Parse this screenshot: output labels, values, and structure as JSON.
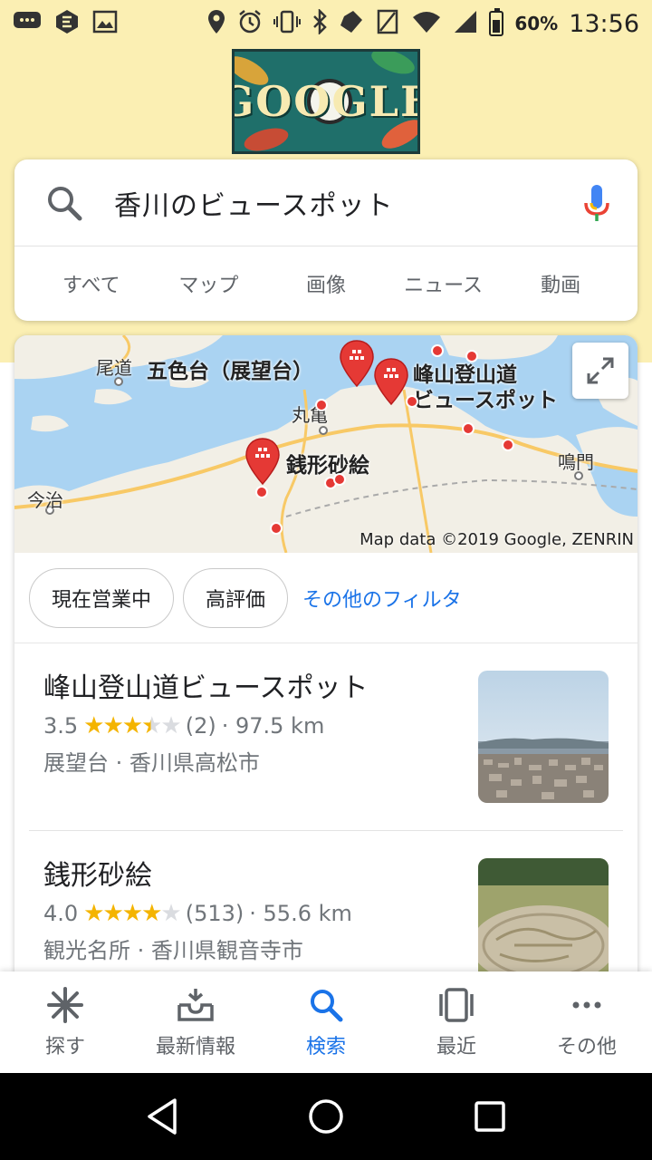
{
  "status_bar": {
    "left_icons": [
      "message-icon",
      "e-app-icon",
      "image-icon"
    ],
    "right_icons": [
      "location-icon",
      "alarm-icon",
      "vibrate-icon",
      "bluetooth-icon",
      "nfc-icon",
      "signal-icon",
      "wifi-icon",
      "cell-signal-icon"
    ],
    "battery": "60%",
    "time": "13:56"
  },
  "doodle": {
    "text": "GOOGLE"
  },
  "search": {
    "query": "香川のビュースポット",
    "tabs": [
      "すべて",
      "マップ",
      "画像",
      "ニュース",
      "動画"
    ]
  },
  "map": {
    "labels": {
      "onomichi": "尾道",
      "goshikidai": "五色台（展望台）",
      "minezan": "峰山登山道",
      "minezan2": "ビュースポット",
      "marugame": "丸亀",
      "zenigata": "銭形砂絵",
      "naruto": "鳴門",
      "imabari": "今治"
    },
    "credit": "Map data ©2019 Google, ZENRIN"
  },
  "filters": {
    "chips": [
      "現在営業中",
      "高評価"
    ],
    "more": "その他のフィルタ"
  },
  "results": [
    {
      "name": "峰山登山道ビュースポット",
      "rating": "3.5",
      "rating_value": 3.5,
      "reviews": "(2)",
      "distance": "· 97.5 km",
      "type": "展望台 · 香川県高松市"
    },
    {
      "name": "銭形砂絵",
      "rating": "4.0",
      "rating_value": 4.0,
      "reviews": "(513)",
      "distance": "· 55.6 km",
      "type": "観光名所 · 香川県観音寺市"
    }
  ],
  "bottom_nav": [
    {
      "label": "探す",
      "icon": "explore-icon"
    },
    {
      "label": "最新情報",
      "icon": "updates-icon"
    },
    {
      "label": "検索",
      "icon": "search-icon",
      "active": true
    },
    {
      "label": "最近",
      "icon": "recent-icon"
    },
    {
      "label": "その他",
      "icon": "more-icon"
    }
  ],
  "colors": {
    "accent": "#1a73e8",
    "band": "#fbefb3",
    "pin": "#e53935",
    "star": "#f4b400"
  }
}
